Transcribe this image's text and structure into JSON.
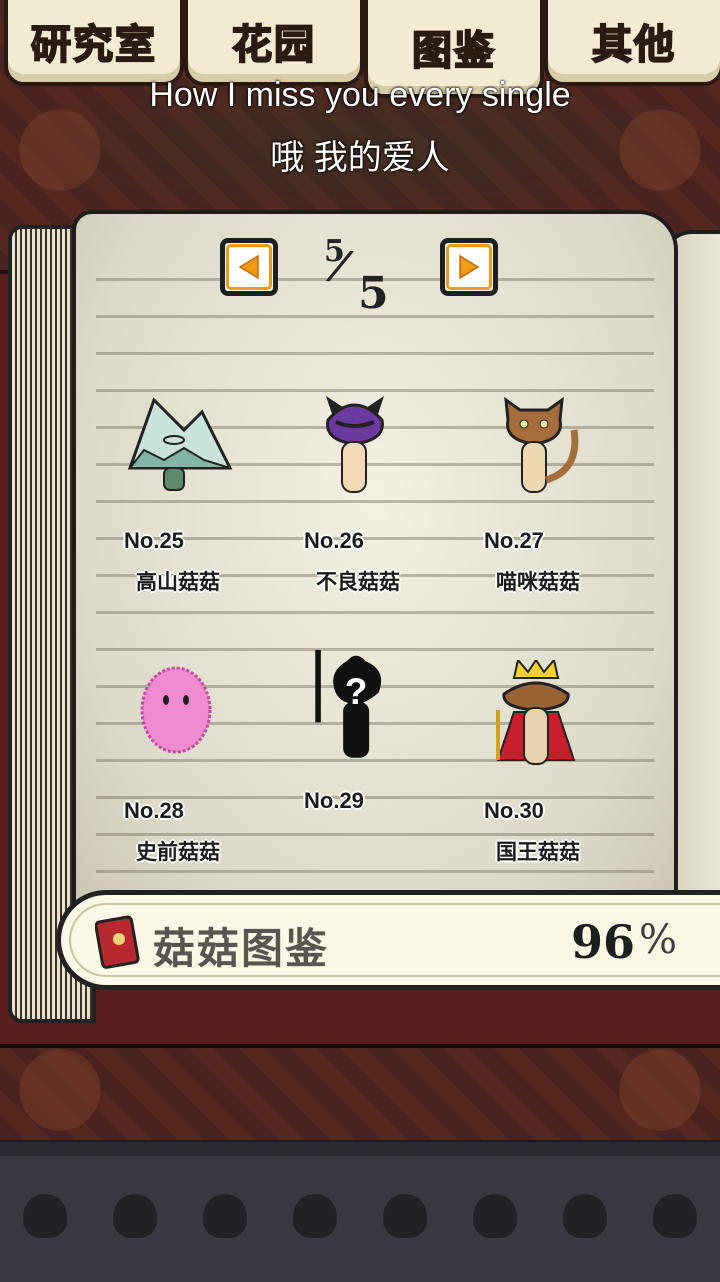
{
  "tabs": [
    {
      "label": "研究室",
      "active": false
    },
    {
      "label": "花园",
      "active": false
    },
    {
      "label": "图鉴",
      "active": true
    },
    {
      "label": "其他",
      "active": false
    }
  ],
  "subtitle": {
    "line1": "How I miss you every single",
    "line2": "哦 我的爱人"
  },
  "pager": {
    "current": "5",
    "total": "5",
    "prev_icon": "arrow-left-icon",
    "next_icon": "arrow-right-icon"
  },
  "entries": [
    {
      "number": "No.25",
      "name": "高山菇菇",
      "icon": "mountain-mushroom-icon"
    },
    {
      "number": "No.26",
      "name": "不良菇菇",
      "icon": "delinquent-mushroom-icon"
    },
    {
      "number": "No.27",
      "name": "喵咪菇菇",
      "icon": "cat-mushroom-icon"
    },
    {
      "number": "No.28",
      "name": "史前菇菇",
      "icon": "prehistoric-mushroom-icon"
    },
    {
      "number": "No.29",
      "name": "",
      "icon": "unknown-silhouette-icon"
    },
    {
      "number": "No.30",
      "name": "国王菇菇",
      "icon": "king-mushroom-icon"
    }
  ],
  "collection": {
    "label": "菇菇图鉴",
    "percent": "96",
    "percent_sign": "%",
    "icon": "red-book-icon"
  },
  "colors": {
    "tab_active_text": "#ffde2a",
    "nav_border": "#f19a16",
    "nav_arrow": "#f19a16"
  }
}
